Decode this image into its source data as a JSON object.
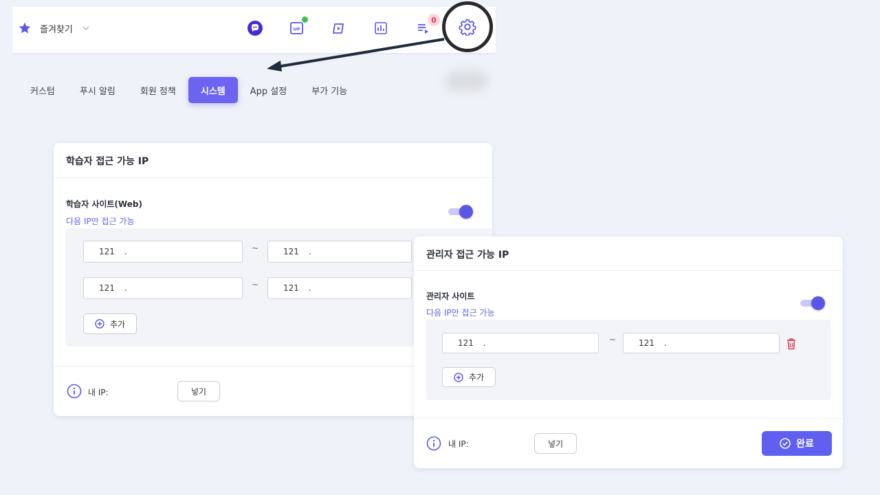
{
  "topbar": {
    "favorites_label": "즐겨찾기",
    "icons": [
      "chat-icon",
      "uplus-icon",
      "video-icon",
      "chart-icon",
      "queue-icon",
      "settings-icon"
    ],
    "queue_badge": "0"
  },
  "tabs": [
    {
      "label": "커스텀",
      "active": false
    },
    {
      "label": "푸시 알림",
      "active": false
    },
    {
      "label": "회원 정책",
      "active": false
    },
    {
      "label": "시스템",
      "active": true
    },
    {
      "label": "App 설정",
      "active": false
    },
    {
      "label": "부가 기능",
      "active": false
    }
  ],
  "learner_card": {
    "title": "학습자 접근 가능 IP",
    "section_title": "학습자 사이트(Web)",
    "section_desc": "다음 IP만 접근 가능",
    "toggle_on": true,
    "ranges": [
      {
        "from": "121",
        "to": "121"
      },
      {
        "from": "121",
        "to": "121"
      }
    ],
    "dot": ".",
    "tilde": "~",
    "add_label": "추가",
    "my_ip_label": "내 IP:",
    "insert_label": "넣기"
  },
  "admin_card": {
    "title": "관리자 접근 가능 IP",
    "section_title": "관리자 사이트",
    "section_desc": "다음 IP만 접근 가능",
    "toggle_on": true,
    "ranges": [
      {
        "from": "121",
        "to": "121"
      }
    ],
    "dot": ".",
    "tilde": "~",
    "add_label": "추가",
    "my_ip_label": "내 IP:",
    "insert_label": "넣기",
    "done_label": "완료"
  },
  "colors": {
    "accent": "#6c63f0",
    "badge_red": "#e43b57",
    "online_green": "#3dc23d",
    "link_blue": "#5f64e2"
  }
}
